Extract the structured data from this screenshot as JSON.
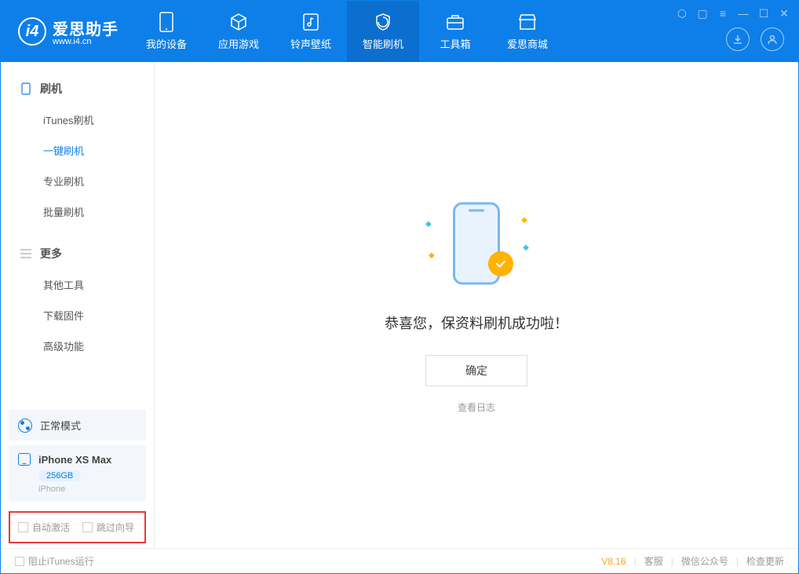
{
  "app": {
    "name_cn": "爱思助手",
    "name_en": "www.i4.cn"
  },
  "nav": [
    {
      "label": "我的设备"
    },
    {
      "label": "应用游戏"
    },
    {
      "label": "铃声壁纸"
    },
    {
      "label": "智能刷机",
      "active": true
    },
    {
      "label": "工具箱"
    },
    {
      "label": "爱思商城"
    }
  ],
  "sidebar": {
    "group1": {
      "title": "刷机",
      "items": [
        "iTunes刷机",
        "一键刷机",
        "专业刷机",
        "批量刷机"
      ],
      "active_index": 1
    },
    "group2": {
      "title": "更多",
      "items": [
        "其他工具",
        "下载固件",
        "高级功能"
      ]
    }
  },
  "mode": {
    "label": "正常模式"
  },
  "device": {
    "name": "iPhone XS Max",
    "storage": "256GB",
    "type": "iPhone"
  },
  "options": {
    "auto_activate": "自动激活",
    "skip_guide": "跳过向导"
  },
  "main": {
    "success_msg": "恭喜您，保资料刷机成功啦！",
    "ok_button": "确定",
    "log_link": "查看日志"
  },
  "footer": {
    "block_itunes": "阻止iTunes运行",
    "version": "V8.16",
    "support": "客服",
    "wechat": "微信公众号",
    "update": "检查更新"
  }
}
